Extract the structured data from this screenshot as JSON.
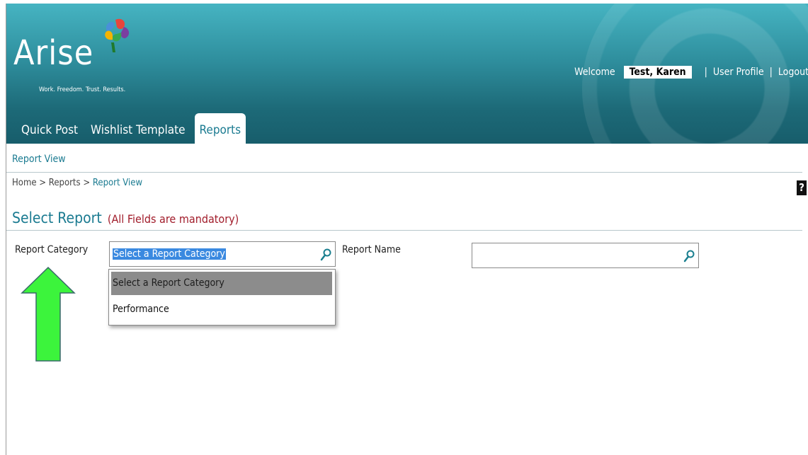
{
  "brand": {
    "name": "Arise",
    "tagline": "Work. Freedom. Trust. Results."
  },
  "header": {
    "welcome_label": "Welcome",
    "user_name": "Test, Karen",
    "separator": "|",
    "user_profile": "User Profile",
    "logout": "Logout"
  },
  "tabs": [
    {
      "label": "Quick Post"
    },
    {
      "label": "Wishlist Template"
    },
    {
      "label": "Reports",
      "active": true
    }
  ],
  "page": {
    "section_link": "Report View",
    "breadcrumb": {
      "home": "Home",
      "sep": ">",
      "reports": "Reports",
      "current": "Report View"
    },
    "help_label": "?",
    "title": "Select Report",
    "note": "(All Fields are mandatory)"
  },
  "form": {
    "category_label": "Report Category",
    "category_value": "Select a Report Category",
    "name_label": "Report Name",
    "name_value": "",
    "options": [
      "Select a Report Category",
      "Performance"
    ]
  },
  "colors": {
    "accent": "#1b7b91",
    "header": "#2f8f9e",
    "note": "#a11c2a",
    "arrow": "#3cf43c"
  },
  "icons": [
    "search-icon",
    "help-icon",
    "logo-petals-icon",
    "arrow-up-icon"
  ]
}
